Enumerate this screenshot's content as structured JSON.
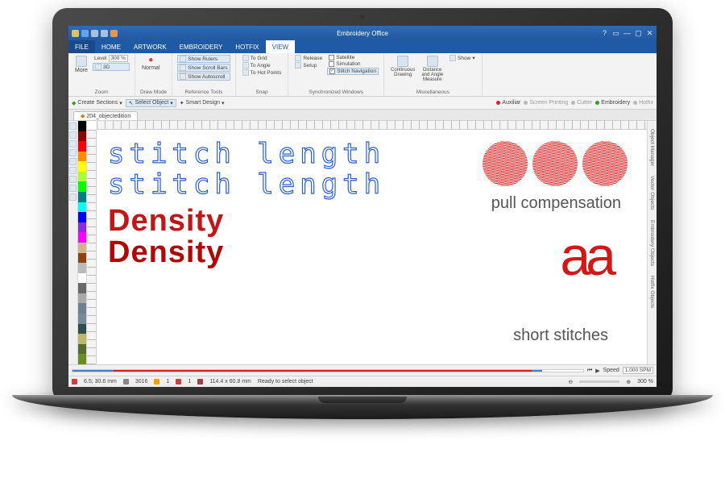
{
  "app_title": "Embroidery Office",
  "menu": {
    "file": "FILE",
    "tabs": [
      "HOME",
      "ARTWORK",
      "EMBROIDERY",
      "HOTFIX",
      "VIEW"
    ],
    "active": "VIEW"
  },
  "ribbon": {
    "zoom": {
      "more": "More",
      "level_label": "Level",
      "level": "300 %",
      "d3": "3D",
      "group": "Zoom"
    },
    "drawmode": {
      "normal": "Normal",
      "group": "Draw Mode"
    },
    "reference": {
      "items": [
        "Show Rulers",
        "Show Scroll Bars",
        "Show Autoscroll"
      ],
      "group": "Reference Tools"
    },
    "snap": {
      "items": [
        "To Grid",
        "To Angle",
        "To Hot Points"
      ],
      "group": "Snap"
    },
    "syncwin": {
      "checks": [
        "Satellite",
        "Simulation",
        "Stitch Navigation"
      ],
      "release": "Release",
      "setup": "Setup",
      "group": "Synchronized Windows"
    },
    "misc": {
      "continuous": "Continuous\nDrawing",
      "distance": "Distance\nand Angle\nMeasure",
      "show": "Show",
      "group": "Miscellaneous"
    }
  },
  "toolstrip": {
    "left": [
      "Create Sections",
      "Select Object",
      "Smart Design"
    ],
    "right": [
      {
        "dot": "#e02020",
        "label": "Auxiliar"
      },
      {
        "dot": "#808080",
        "label": "Screen Printing"
      },
      {
        "dot": "#808080",
        "label": "Cutter"
      },
      {
        "dot": "#2a9d2a",
        "label": "Embroidery"
      },
      {
        "dot": "#808080",
        "label": "Hotfix"
      }
    ]
  },
  "doc_tab": "204_objectedition",
  "palette": [
    "#000",
    "#8b0000",
    "#f00",
    "#ff8c00",
    "#ff0",
    "#adff2f",
    "#0f0",
    "#008080",
    "#0ff",
    "#00f",
    "#8a2be2",
    "#f0f",
    "#d2b48c",
    "#8b4513",
    "#bbb",
    "#fff",
    "#696969",
    "#a9a9a9",
    "#708090",
    "#778899",
    "#2f4f4f",
    "#bdb76b",
    "#556b2f",
    "#6b8e23"
  ],
  "right_tabs": [
    "Object Manager",
    "Vector Objects",
    "Embroidery Objects",
    "Hotfix Objects"
  ],
  "canvas": {
    "stitch1": "stitch length",
    "stitch2": "stitch length",
    "density1": "Density",
    "density2": "Density",
    "pull": "pull compensation",
    "short": "short stitches",
    "aa": "aa"
  },
  "playbar": {
    "speed_label": "Speed",
    "speed_val": "1.000 SPM"
  },
  "status": {
    "pos": "6.5; 30.6 mm",
    "stitches": "3016",
    "stops": "1",
    "warn": "1",
    "size": "114.4 x 60.8 mm",
    "msg": "Ready to select object",
    "zoom": "300 %"
  }
}
